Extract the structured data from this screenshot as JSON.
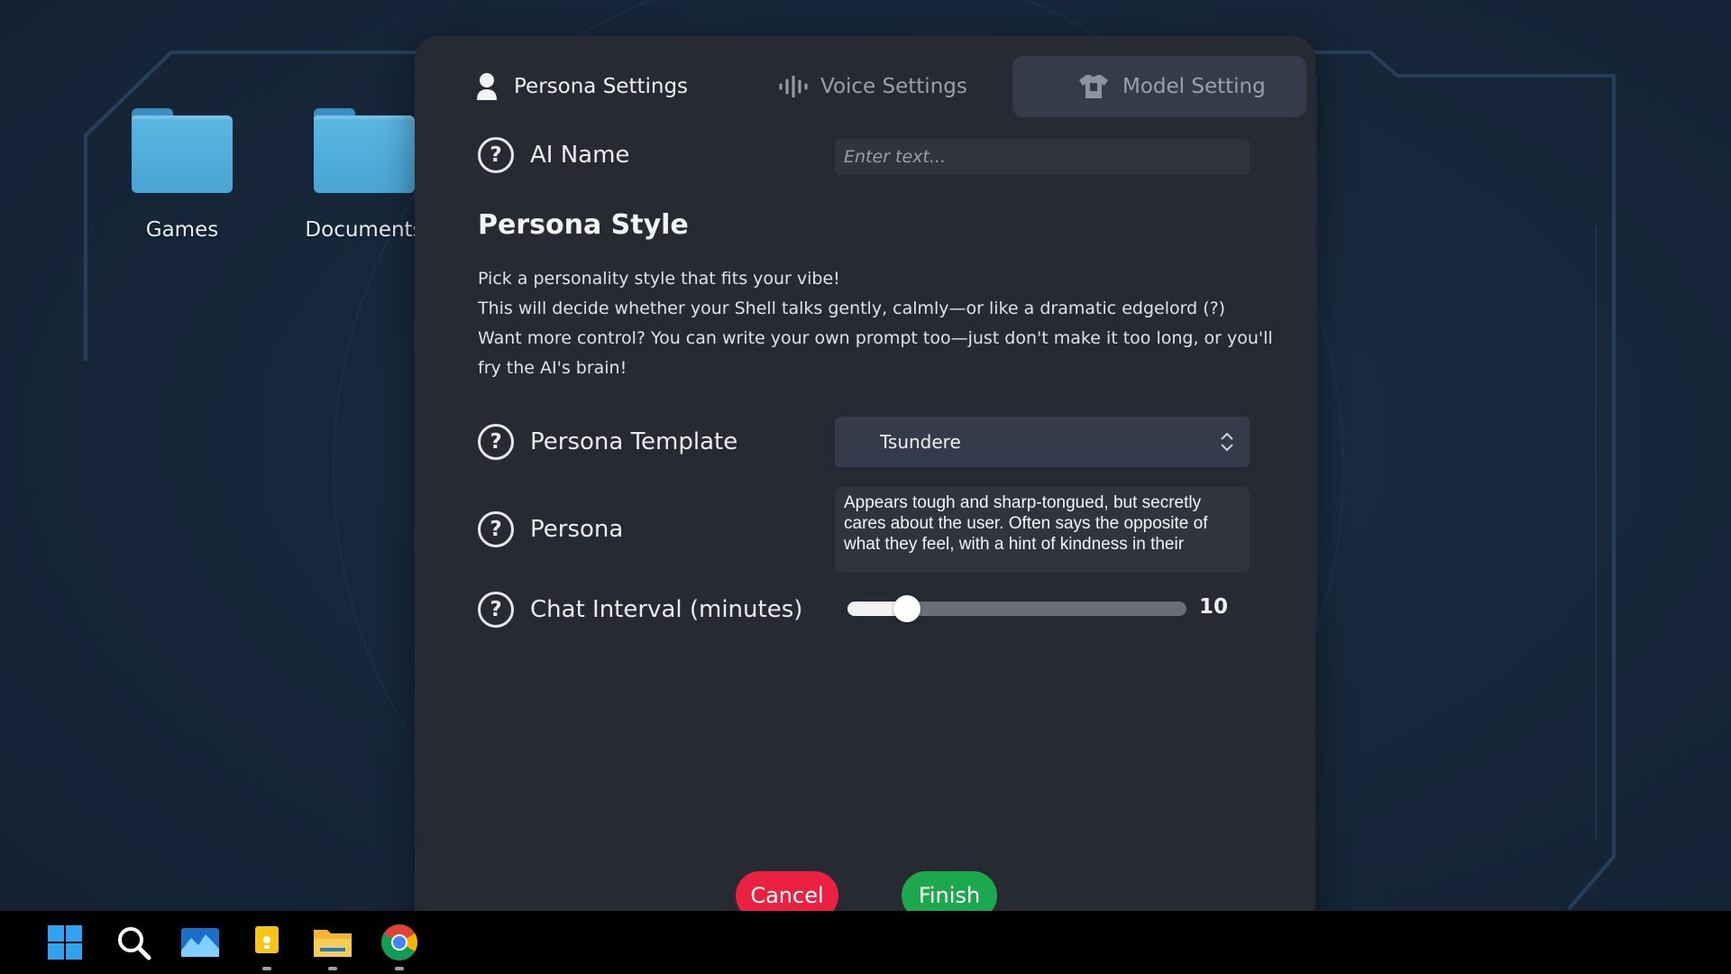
{
  "desktop": {
    "icons": [
      {
        "label": "Games",
        "icon": "folder-icon"
      },
      {
        "label": "Documents",
        "icon": "folder-icon"
      }
    ]
  },
  "dialog": {
    "tabs": [
      {
        "label": "Persona Settings",
        "icon": "person-icon",
        "state": "current"
      },
      {
        "label": "Voice Settings",
        "icon": "voice-wave-icon",
        "state": "inactive"
      },
      {
        "label": "Model Setting",
        "icon": "shirt-icon",
        "state": "highlighted"
      }
    ],
    "ai_name": {
      "label": "AI Name",
      "placeholder": "Enter text...",
      "value": ""
    },
    "persona_style": {
      "title": "Persona Style",
      "lines": [
        "Pick a personality style that fits your vibe!",
        "This will decide whether your Shell talks gently, calmly—or like a dramatic edgelord (?)",
        "Want more control? You can write your own prompt too—just don't make it too long, or you'll",
        "fry the AI's brain!"
      ]
    },
    "persona_template": {
      "label": "Persona Template",
      "selected": "Tsundere"
    },
    "persona": {
      "label": "Persona",
      "text": "Appears tough and sharp-tongued, but secretly cares about the user. Often says the opposite of what they feel, with a hint of kindness in their"
    },
    "chat_interval": {
      "label": "Chat Interval (minutes)",
      "value": "10",
      "fraction": 0.175
    },
    "buttons": {
      "cancel": "Cancel",
      "finish": "Finish"
    },
    "help_glyph": "?"
  },
  "taskbar": {
    "items": [
      "windows-start-icon",
      "search-icon",
      "photos-icon",
      "sticky-notes-icon",
      "file-explorer-icon",
      "chrome-icon"
    ]
  },
  "colors": {
    "cancel": "#ea2141",
    "finish": "#1ea84d",
    "dialog_bg": "#272a33",
    "selected_tab_bg": "#363b4b"
  }
}
